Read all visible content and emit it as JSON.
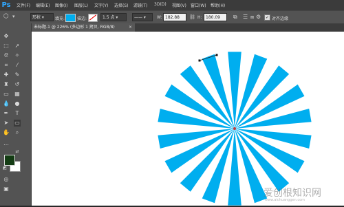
{
  "app": {
    "logo": "Ps"
  },
  "menu": [
    "文件(F)",
    "编辑(E)",
    "图像(I)",
    "图层(L)",
    "文字(Y)",
    "选择(S)",
    "滤镜(T)",
    "3D(D)",
    "视图(V)",
    "窗口(W)",
    "帮助(H)"
  ],
  "options": {
    "shape_mode": "形状",
    "fill_label": "填充:",
    "fill_color": "#00aeef",
    "stroke_label": "描边:",
    "stroke_width": "1.5 点",
    "w_label": "W:",
    "w_value": "182.88",
    "h_label": "H:",
    "h_value": "180.09",
    "align_edges_label": "对齐边缘",
    "align_edges_checked": "✓"
  },
  "document": {
    "tab_title": "未标题-1 @ 226% (多边形 1 拷贝, RGB/8)",
    "tab_close": "×"
  },
  "colors": {
    "foreground": "#143c14",
    "background": "#ffffff",
    "ray_color": "#00aeef"
  },
  "watermark": {
    "text": "爱创根知识网",
    "url": "www.aichuanggen.com"
  }
}
